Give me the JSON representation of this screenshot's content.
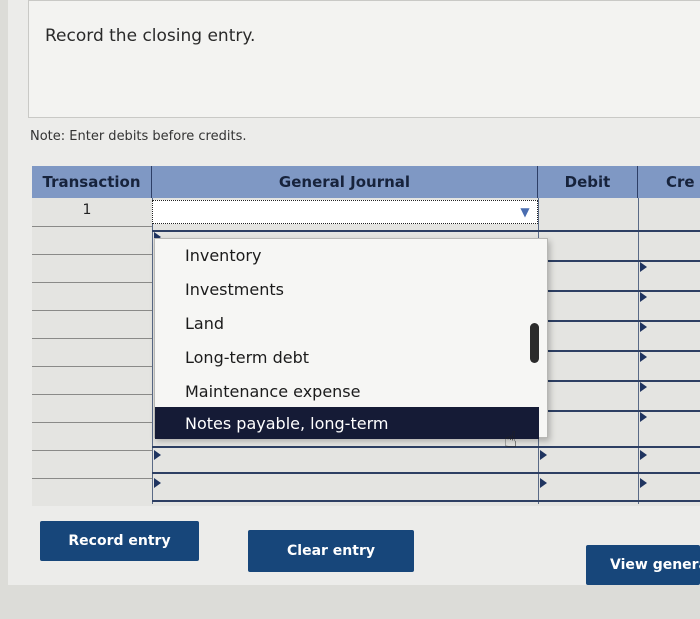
{
  "instructions": {
    "text": "Record the closing entry."
  },
  "note": {
    "text": "Note: Enter debits before credits."
  },
  "table": {
    "headers": {
      "transaction": "Transaction",
      "journal": "General Journal",
      "debit": "Debit",
      "credit": "Cre"
    },
    "first_row": {
      "transaction": "1",
      "journal_value": ""
    }
  },
  "dropdown": {
    "options": [
      "Inventory",
      "Investments",
      "Land",
      "Long-term debt",
      "Maintenance expense",
      "Notes payable, long-term"
    ],
    "selected_index": 5
  },
  "buttons": {
    "record": "Record entry",
    "clear": "Clear entry",
    "view": "View genera"
  },
  "colors": {
    "header_bg": "#7f98c4",
    "button_bg": "#17467a",
    "selected_bg": "#151b36"
  }
}
